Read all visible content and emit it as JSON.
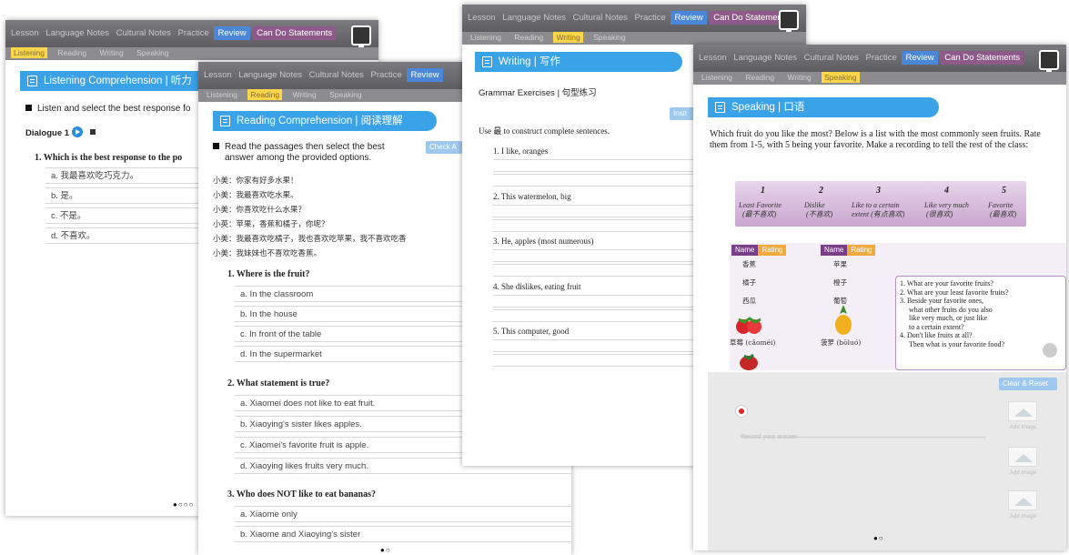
{
  "nav": {
    "tabs": [
      "Lesson",
      "Language Notes",
      "Cultural Notes",
      "Practice",
      "Review",
      "Can Do Statements"
    ],
    "active_tab": "Review"
  },
  "screen1": {
    "sub_tabs": [
      "Listening",
      "Reading",
      "Writing",
      "Speaking"
    ],
    "active_sub": "Listening",
    "section_title": "Listening Comprehension | 听力",
    "instruction": "Listen and select the best response fo",
    "dialogue_label": "Dialogue 1",
    "question": "1.   Which is the best response to the po",
    "options": [
      "a. 我最喜欢吃巧克力。",
      "b. 是。",
      "c. 不是。",
      "d. 不喜欢。"
    ],
    "pager": "●○○○"
  },
  "screen2": {
    "sub_tabs": [
      "Listening",
      "Reading",
      "Writing",
      "Speaking"
    ],
    "active_sub": "Reading",
    "section_title": "Reading Comprehension | 阅读理解",
    "check_button": "Check A",
    "instruction_line1": "Read the passages then select the best",
    "instruction_line2": "answer among the provided options.",
    "passage": [
      "小美：你家有好多水果！",
      "小美：我最喜欢吃水果。",
      "小美：你喜欢吃什么水果？",
      "小英：苹果，香蕉和橘子，你呢？",
      "小美：我最喜欢吃橘子，我也喜欢吃苹果，我不喜欢吃香",
      "小美：我妹妹也不喜欢吃香蕉。"
    ],
    "q1": "1.   Where is the fruit?",
    "q1_options": [
      "a. In the classroom",
      "b. In the house",
      "c. In front of the table",
      "d. In the supermarket"
    ],
    "q2": "2.   What statement is true?",
    "q2_options": [
      "a. Xiaomei does not like to eat fruit.",
      "b. Xiaoying's sister likes apples.",
      "c. Xiaomei's favorite fruit is apple.",
      "d. Xiaoying likes fruits very much."
    ],
    "q3": "3.   Who does NOT like to eat bananas?",
    "q3_options": [
      "a. Xiaome only",
      "b. Xiaome and Xiaoying's sister"
    ],
    "pager": "●○"
  },
  "screen3": {
    "sub_tabs": [
      "Listening",
      "Reading",
      "Writing",
      "Speaking"
    ],
    "active_sub": "Writing",
    "section_title": "Writing | 写作",
    "subtitle": "Grammar Exercises | 句型练习",
    "button": "Instr",
    "instruction": "Use 最 to construct complete sentences.",
    "items": [
      "1. I like, oranges",
      "2. This watermelon, big",
      "3. He, apples (most numerous)",
      "4. She dislikes, eating fruit",
      "5. This computer, good"
    ]
  },
  "screen4": {
    "sub_tabs": [
      "Listening",
      "Reading",
      "Writing",
      "Speaking"
    ],
    "active_sub": "Speaking",
    "section_title": "Speaking | 口语",
    "paragraph": "Which fruit do you like the most? Below is a list with the most commonly seen fruits. Rate them from 1-5, with 5 being your favorite. Make a recording to tell the rest of the class:",
    "ratings": [
      {
        "num": "1",
        "label": "Least Favorite",
        "cn": "(最不喜欢)"
      },
      {
        "num": "2",
        "label": "Dislike",
        "cn": "(不喜欢)"
      },
      {
        "num": "3",
        "label": "Like to a certain",
        "cn": "extent (有点喜欢)"
      },
      {
        "num": "4",
        "label": "Like very much",
        "cn": "(很喜欢)"
      },
      {
        "num": "5",
        "label": "Favorite",
        "cn": "(最喜欢)"
      }
    ],
    "col_name": "Name",
    "col_rating": "Rating",
    "fruits_left": [
      "香蕉",
      "橘子",
      "西瓜",
      "草莓 (cǎoméi)"
    ],
    "fruits_right": [
      "苹果",
      "橙子",
      "葡萄",
      "菠萝 (bōluó)"
    ],
    "questions": [
      "1. What are your favorite fruits?",
      "2. What are your least favorite fruits?",
      "3. Beside your favorite ones,",
      "what other fruits do you also",
      "like very much, or just like",
      "to a certain extent?",
      "4. Don't like fruits at all?",
      "Then what is your favorite food?"
    ],
    "clear_button": "Clear & Reset",
    "placeholder": "Record your answer",
    "image_caption": "Add Image",
    "pager": "●○"
  },
  "colors": {
    "title_bar": "#3aa3e8",
    "active_tab": "#4a87d8",
    "navbar": "#6b6b70",
    "rating_bg": "#d8bfdd"
  }
}
